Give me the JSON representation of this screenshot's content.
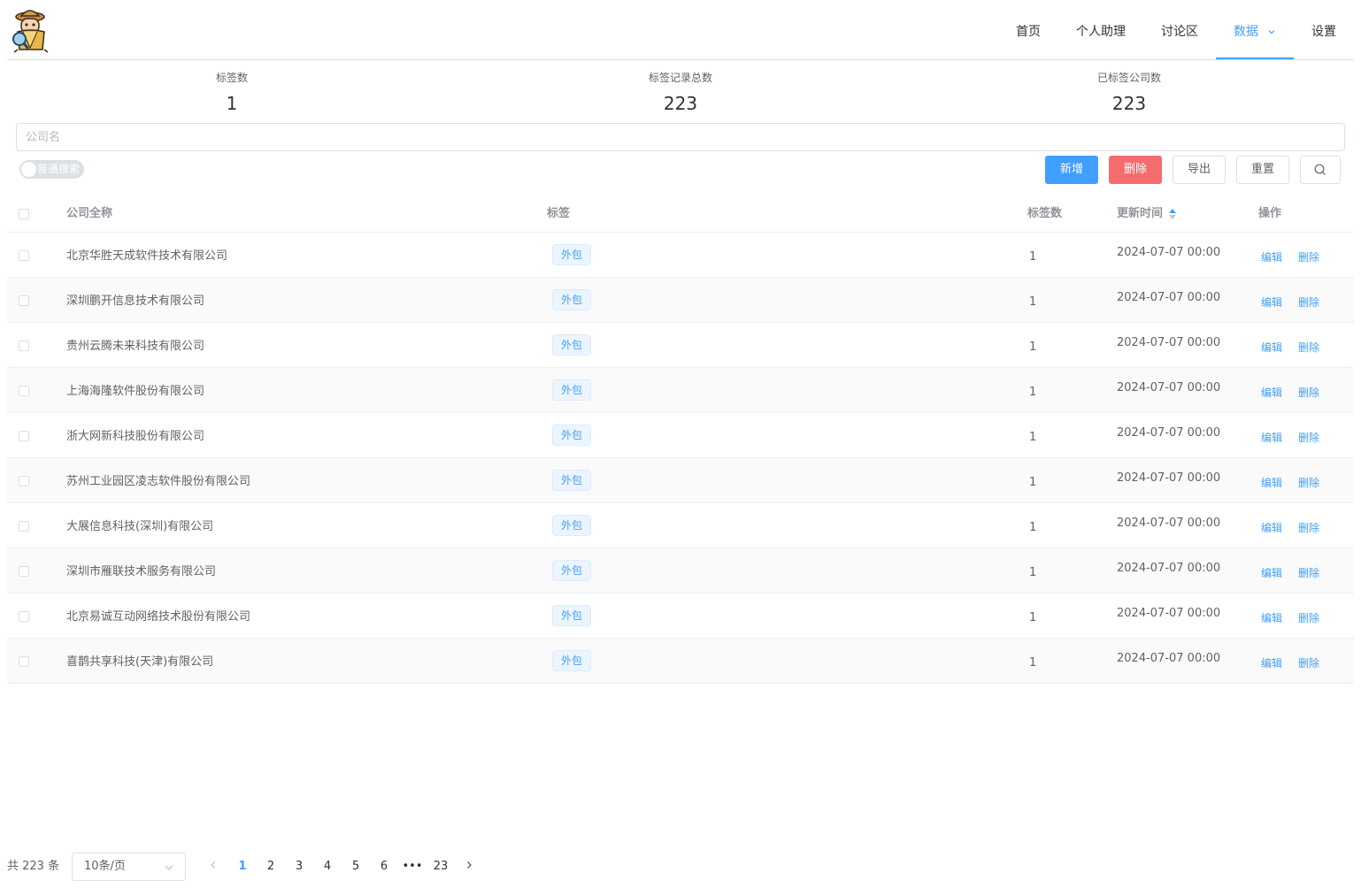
{
  "header": {
    "nav": [
      {
        "label": "首页",
        "active": false
      },
      {
        "label": "个人助理",
        "active": false
      },
      {
        "label": "讨论区",
        "active": false
      },
      {
        "label": "数据",
        "active": true,
        "dropdown": true
      },
      {
        "label": "设置",
        "active": false
      }
    ]
  },
  "stats": [
    {
      "label": "标签数",
      "value": "1"
    },
    {
      "label": "标签记录总数",
      "value": "223"
    },
    {
      "label": "已标签公司数",
      "value": "223"
    }
  ],
  "search": {
    "placeholder": "公司名",
    "value": ""
  },
  "toggle": {
    "label": "普通搜索",
    "on": false
  },
  "toolbar": {
    "add": "新增",
    "delete": "删除",
    "export": "导出",
    "reset": "重置",
    "search_icon": "search-icon"
  },
  "table": {
    "headers": {
      "name": "公司全称",
      "tag": "标签",
      "count": "标签数",
      "time": "更新时间",
      "op": "操作"
    },
    "op_labels": {
      "edit": "编辑",
      "delete": "删除"
    },
    "rows": [
      {
        "name": "北京华胜天成软件技术有限公司",
        "tag": "外包",
        "count": "1",
        "time": "2024-07-07 00:00"
      },
      {
        "name": "深圳鹏开信息技术有限公司",
        "tag": "外包",
        "count": "1",
        "time": "2024-07-07 00:00"
      },
      {
        "name": "贵州云腾未来科技有限公司",
        "tag": "外包",
        "count": "1",
        "time": "2024-07-07 00:00"
      },
      {
        "name": "上海海隆软件股份有限公司",
        "tag": "外包",
        "count": "1",
        "time": "2024-07-07 00:00"
      },
      {
        "name": "浙大网新科技股份有限公司",
        "tag": "外包",
        "count": "1",
        "time": "2024-07-07 00:00"
      },
      {
        "name": "苏州工业园区凌志软件股份有限公司",
        "tag": "外包",
        "count": "1",
        "time": "2024-07-07 00:00"
      },
      {
        "name": "大展信息科技(深圳)有限公司",
        "tag": "外包",
        "count": "1",
        "time": "2024-07-07 00:00"
      },
      {
        "name": "深圳市雁联技术服务有限公司",
        "tag": "外包",
        "count": "1",
        "time": "2024-07-07 00:00"
      },
      {
        "name": "北京易诚互动网络技术股份有限公司",
        "tag": "外包",
        "count": "1",
        "time": "2024-07-07 00:00"
      },
      {
        "name": "喜鹊共享科技(天津)有限公司",
        "tag": "外包",
        "count": "1",
        "time": "2024-07-07 00:00"
      }
    ]
  },
  "pagination": {
    "total": "共 223 条",
    "page_size": "10条/页",
    "pages": [
      "1",
      "2",
      "3",
      "4",
      "5",
      "6",
      "•••",
      "23"
    ],
    "current": "1"
  },
  "colors": {
    "primary": "#409eff",
    "danger": "#f56c6c",
    "border": "#dcdfe6"
  }
}
